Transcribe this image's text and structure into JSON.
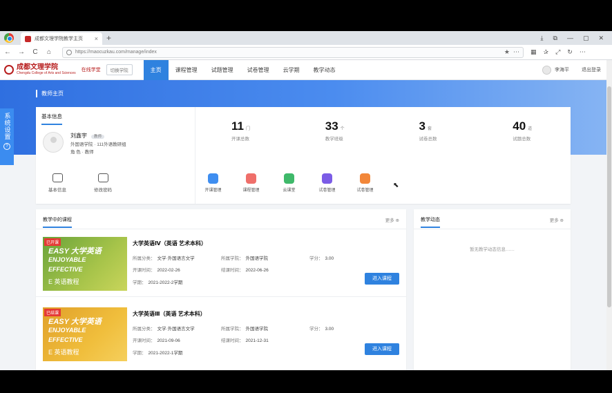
{
  "browser": {
    "tab_title": "成都文理学院教学主页",
    "tab_close": "×",
    "new_tab": "+",
    "url": "https://maocuzkau.com/manage/index",
    "window_controls": [
      "⤓",
      "⧉",
      "—",
      "▢",
      "✕"
    ],
    "nav_buttons": [
      "←",
      "→",
      "C",
      "⌂"
    ],
    "url_star": "★",
    "url_more": "⋯",
    "toolbar_icons": [
      "▦",
      "✰",
      "⤢",
      "↻",
      "⋯"
    ]
  },
  "site": {
    "logo_name": "成都文理学院",
    "logo_sub": "Chengdu College of Arts and Sciences",
    "logo_tag": "在线学堂",
    "switch_label": "切换学院",
    "nav": [
      "主页",
      "课程管理",
      "试题管理",
      "试卷管理",
      "云学期",
      "教学动态"
    ],
    "user_name": "李海平",
    "logout_label": "退出登录"
  },
  "hero": {
    "title": "教师主页"
  },
  "side_tab": {
    "label": "系统设置",
    "icon": "?"
  },
  "info_card": {
    "section_title": "基本信息",
    "name": "刘鑫宇",
    "role": "教师",
    "line1": "外国语学院 · 111外语教研组",
    "line2": "角  色 · 教师",
    "quick_links": [
      "基本信息",
      "修改密码"
    ],
    "stats": [
      {
        "num": "11",
        "unit": "门",
        "label": "开课总数"
      },
      {
        "num": "33",
        "unit": "个",
        "label": "教学班级"
      },
      {
        "num": "3",
        "unit": "套",
        "label": "试卷总数"
      },
      {
        "num": "40",
        "unit": "道",
        "label": "试题总数"
      }
    ],
    "tools": [
      {
        "label": "开课管理",
        "color": "#3f8ef0"
      },
      {
        "label": "课程管理",
        "color": "#ef6f6a"
      },
      {
        "label": "云课堂",
        "color": "#3fb96a"
      },
      {
        "label": "试卷管理",
        "color": "#7b5ce6"
      },
      {
        "label": "试卷管理",
        "color": "#f2873a"
      }
    ]
  },
  "courses_card": {
    "title": "教学中的课程",
    "more": "更多 ⊕",
    "courses": [
      {
        "badge": "已开课",
        "thumb": [
          "EASY 大学英语",
          "ENJOYABLE",
          "EFFECTIVE",
          "E 英语教程"
        ],
        "name": "大学英语Ⅳ（英语 艺术本科）",
        "fields": [
          [
            "所属分类",
            "文学·外国语言文学"
          ],
          [
            "所属学院",
            "外国语学院"
          ],
          [
            "学分",
            "3.00"
          ],
          [
            "开课时间",
            "2022-02-26"
          ],
          [
            "结课时间",
            "2022-06-26"
          ],
          [
            "学期",
            "2021-2022-2学期"
          ]
        ],
        "button": "进入课程"
      },
      {
        "badge": "已结课",
        "thumb": [
          "EASY 大学英语",
          "ENJOYABLE",
          "EFFECTIVE",
          "E 英语教程"
        ],
        "name": "大学英语Ⅲ（英语 艺术本科）",
        "fields": [
          [
            "所属分类",
            "文学·外国语言文学"
          ],
          [
            "所属学院",
            "外国语学院"
          ],
          [
            "学分",
            "3.00"
          ],
          [
            "开课时间",
            "2021-09-06"
          ],
          [
            "结课时间",
            "2021-12-31"
          ],
          [
            "学期",
            "2021-2022-1学期"
          ]
        ],
        "button": "进入课程"
      }
    ]
  },
  "dynamics_card": {
    "title": "教学动态",
    "more": "更多 ⊕",
    "empty": "暂无教学动态信息……"
  }
}
